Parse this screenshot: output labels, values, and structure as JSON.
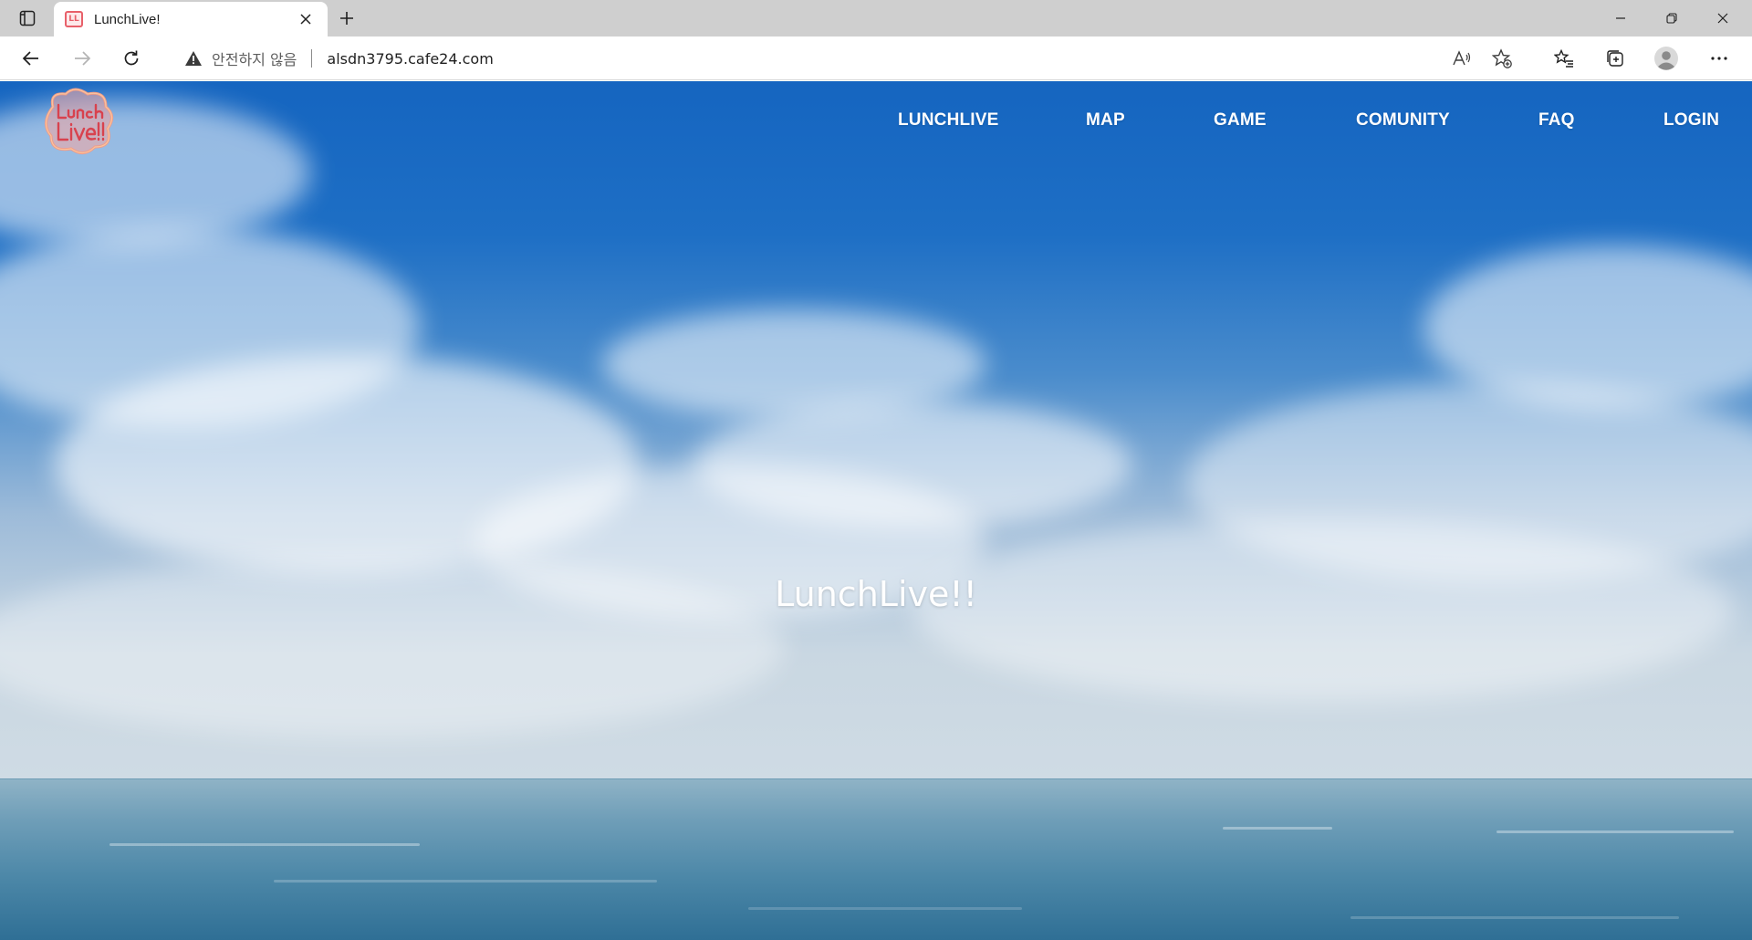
{
  "browser": {
    "tab": {
      "title": "LunchLive!",
      "favicon_icon": "site-favicon"
    },
    "address_bar": {
      "security_label": "안전하지 않음",
      "url": "alsdn3795.cafe24.com"
    }
  },
  "site": {
    "logo": {
      "alt": "Lunch Live!!"
    },
    "nav": [
      {
        "label": "LUNCHLIVE"
      },
      {
        "label": "MAP"
      },
      {
        "label": "GAME"
      },
      {
        "label": "COMUNITY"
      },
      {
        "label": "FAQ"
      },
      {
        "label": "LOGIN"
      }
    ],
    "hero_title": "LunchLive!!"
  },
  "colors": {
    "sky_top": "#1565c0",
    "sky_horizon": "#cfdbe4",
    "sea": "#2f6f95",
    "nav_text": "#ffffff",
    "favicon_accent": "#e8606a"
  }
}
